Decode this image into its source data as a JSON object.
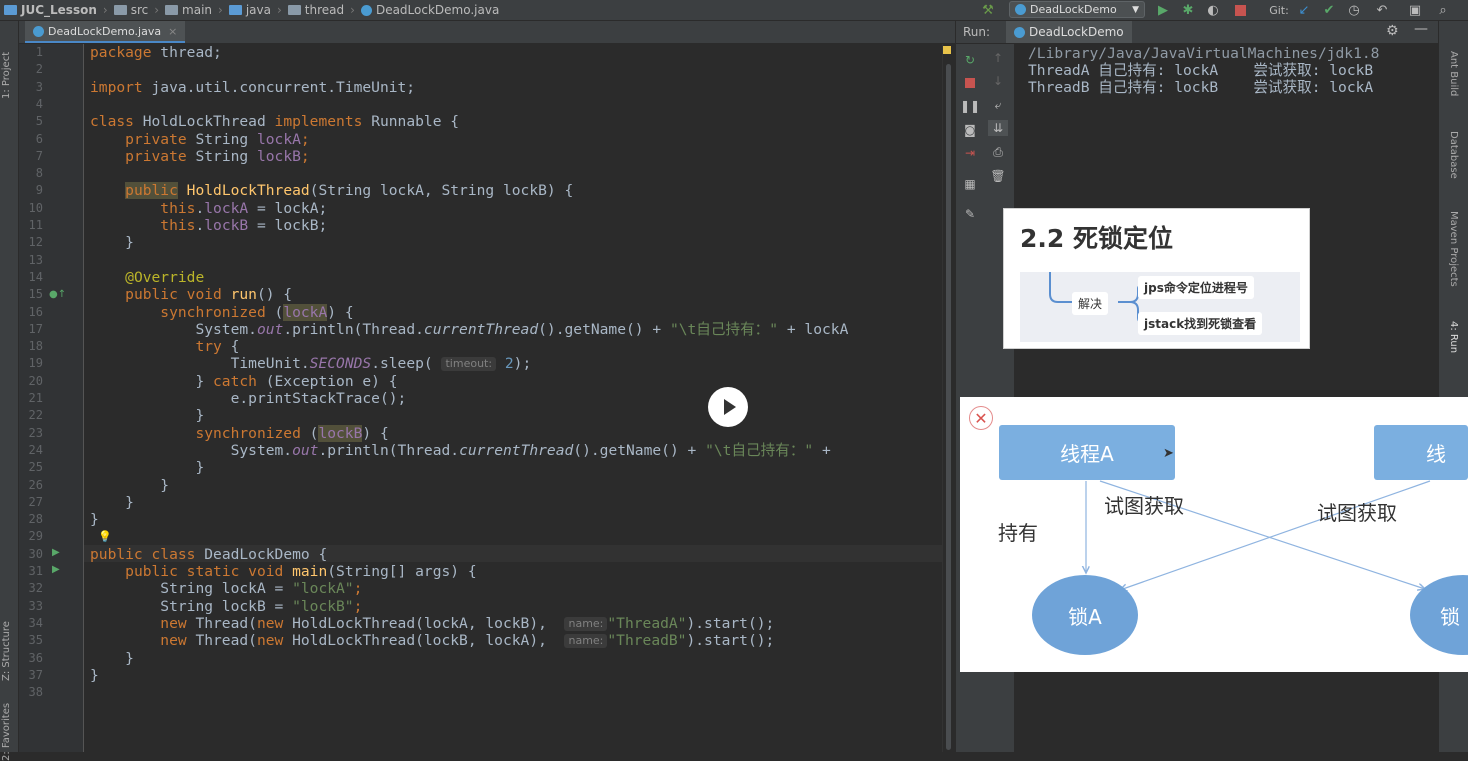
{
  "breadcrumbs": [
    "JUC_Lesson",
    "src",
    "main",
    "java",
    "thread",
    "DeadLockDemo.java"
  ],
  "toolbar": {
    "run_config": "DeadLockDemo",
    "git_label": "Git:"
  },
  "left_strip": {
    "project": "1: Project",
    "structure": "Z: Structure",
    "favorites": "2: Favorites"
  },
  "right_strip": {
    "ant": "Ant Build",
    "database": "Database",
    "maven": "Maven Projects",
    "run": "4: Run"
  },
  "editor": {
    "tab": "DeadLockDemo.java",
    "line_numbers": [
      "1",
      "2",
      "3",
      "4",
      "5",
      "6",
      "7",
      "8",
      "9",
      "10",
      "11",
      "12",
      "13",
      "14",
      "15",
      "16",
      "17",
      "18",
      "19",
      "20",
      "21",
      "22",
      "23",
      "24",
      "25",
      "26",
      "27",
      "28",
      "29",
      "30",
      "31",
      "32",
      "33",
      "34",
      "35",
      "36",
      "37",
      "38"
    ],
    "t": {
      "package": "package",
      "thread_pkg": " thread;",
      "import": "import",
      "import_rest": " java.util.concurrent.TimeUnit;",
      "class": "class",
      "holdname": " HoldLockThread ",
      "implements": "implements",
      "runnable": " Runnable {",
      "private": "private",
      "string": " String ",
      "lockA": "lockA",
      "lockB": "lockB",
      "semi": ";",
      "public": "public",
      "ctor_name": "HoldLockThread",
      "ctor_params": "(String lockA, String lockB) {",
      "this": "this",
      "dot": ".",
      "assignA": " = lockA;",
      "assignB": " = lockB;",
      "close": "}",
      "override": "@Override",
      "void": " void ",
      "run": "run",
      "run_sig": "() {",
      "synchronized": "synchronized",
      "popen": " (",
      "pclose": ") {",
      "sysout": "System.",
      "out": "out",
      "println": ".println(Thread.",
      "current": "currentThread",
      "getname": "().getName() + ",
      "str17": "\"\\t自己持有：\"",
      "tail17": " + lockA",
      "try": "try",
      "brace": " {",
      "timeunit": "TimeUnit.",
      "seconds": "SECONDS",
      "sleep": ".sleep( ",
      "hint_timeout": "timeout:",
      "two": "2",
      "sleep_end": ");",
      "close_catch": "} ",
      "catch": "catch",
      "catch_rest": " (Exception e) {",
      "stack": "e.printStackTrace();",
      "tail24": " +",
      "deadlock": "DeadLockDemo",
      "brace_sp": " {",
      "static": "static",
      "main": "main",
      "main_sig": "(String[] args) {",
      "strA_decl": "String lockA = ",
      "strA": "\"lockA\"",
      "strB_decl": "String lockB = ",
      "strB": "\"lockB\"",
      "new": "new",
      "thread_new": " Thread(",
      "hold_args_A": " HoldLockThread(lockA, lockB),  ",
      "hold_args_B": " HoldLockThread(lockB, lockA),  ",
      "hint_name": "name:",
      "threadA": "\"ThreadA\"",
      "threadB": "\"ThreadB\"",
      "start": ").start();"
    }
  },
  "run_panel": {
    "label": "Run:",
    "tab": "DeadLockDemo",
    "console": [
      "/Library/Java/JavaVirtualMachines/jdk1.8",
      "ThreadA 自己持有: lockA    尝试获取: lockB",
      "ThreadB 自己持有: lockB    尝试获取: lockA"
    ]
  },
  "slide": {
    "title": "2.2 死锁定位",
    "root": "解决",
    "children": [
      "jps命令定位进程号",
      "jstack找到死锁查看"
    ]
  },
  "diagram": {
    "thread_a": "线程A",
    "thread_b_partial": "线",
    "lock_a": "锁A",
    "lock_b_partial": "锁",
    "hold": "持有",
    "try_get_1": "试图获取",
    "try_get_2": "试图获取"
  },
  "colors": {
    "keyword": "#cc7832",
    "string": "#6a8759",
    "field": "#9876aa",
    "number": "#6897bb",
    "node": "#7bafe0"
  }
}
